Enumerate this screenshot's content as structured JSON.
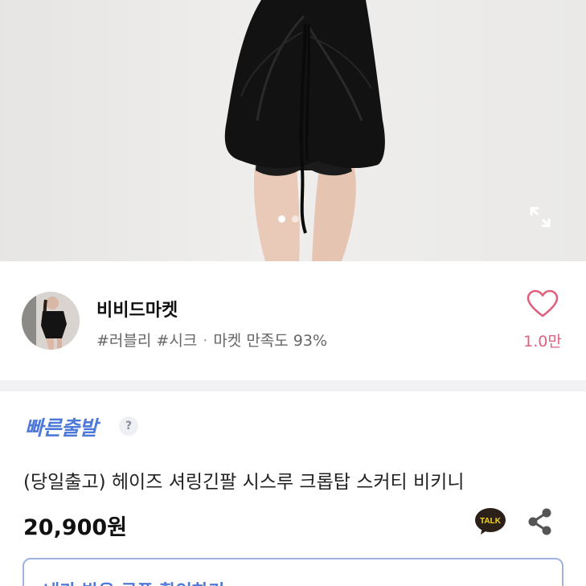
{
  "gallery": {
    "page_count": 2,
    "current_page": 1,
    "expand_icon": "expand-icon"
  },
  "shop": {
    "name": "비비드마켓",
    "tags": "#러블리 #시크",
    "separator": "·",
    "satisfaction": "마켓 만족도 93%",
    "like_count": "1.0만",
    "like_icon": "heart-outline-icon",
    "accent_color": "#e0607e"
  },
  "product": {
    "shipping_badge": "빠른출발",
    "help_symbol": "?",
    "title": "(당일출고) 헤이즈 셔링긴팔 시스루 크롭탑 스커티 비키니",
    "price": "20,900원",
    "talk_label": "TALK",
    "share_icon": "share-icon",
    "badge_color": "#4f79d8"
  },
  "coupon": {
    "label": "내가 받은 쿠폰 확인하기"
  }
}
